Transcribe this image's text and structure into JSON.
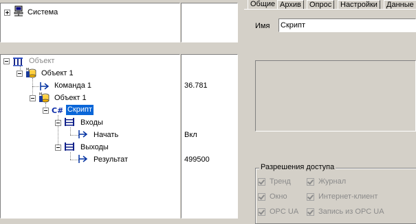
{
  "top_tree": {
    "root_label": "Система"
  },
  "tree": {
    "root_label": "Объект",
    "items": [
      {
        "label": "Объект 1",
        "value": ""
      },
      {
        "label": "Команда 1",
        "value": "36.781"
      },
      {
        "label": "Объект 1",
        "value": ""
      },
      {
        "label": "Скрипт",
        "value": ""
      },
      {
        "label": "Входы",
        "value": ""
      },
      {
        "label": "Начать",
        "value": "Вкл"
      },
      {
        "label": "Выходы",
        "value": ""
      },
      {
        "label": "Результат",
        "value": "499500"
      }
    ]
  },
  "tabs": [
    "Общие",
    "Архив",
    "Опрос",
    "Настройки",
    "Данные"
  ],
  "properties": {
    "name_label": "Имя",
    "name_value": "Скрипт",
    "access_group_label": "Разрешения доступа",
    "access_options": [
      {
        "label": "Тренд",
        "checked": true
      },
      {
        "label": "Журнал",
        "checked": true
      },
      {
        "label": "Окно",
        "checked": true
      },
      {
        "label": "Интернет-клиент",
        "checked": true
      },
      {
        "label": "OPC UA",
        "checked": true
      },
      {
        "label": "Запись из OPC UA",
        "checked": true
      }
    ]
  },
  "colors": {
    "selection": "#0a66d8",
    "disabled_text": "#8a8a8a",
    "window_bg": "#d4d0c8"
  }
}
